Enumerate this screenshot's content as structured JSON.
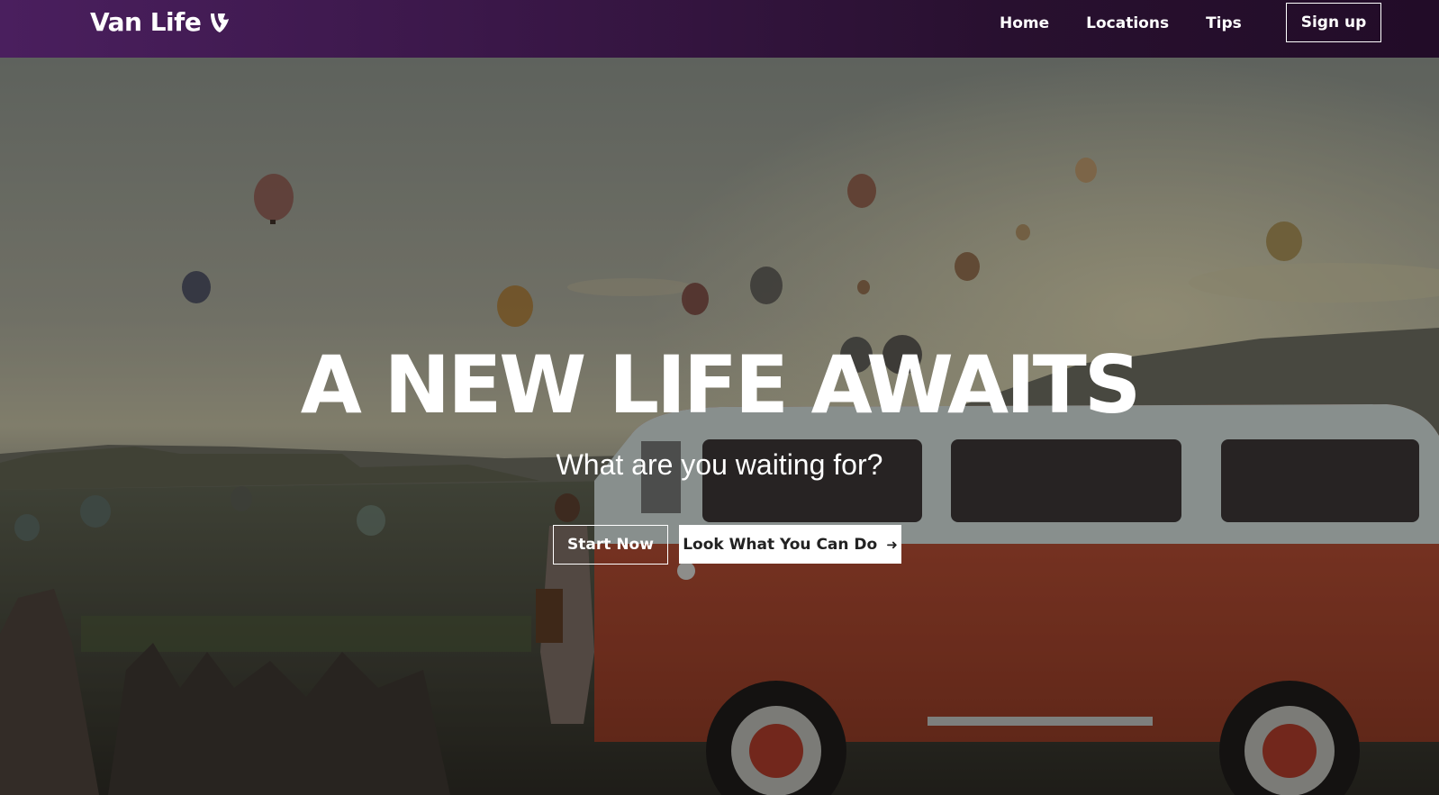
{
  "navbar": {
    "brand": "Van Life",
    "logo_icon": "typo3-logo-icon",
    "links": [
      {
        "label": "Home"
      },
      {
        "label": "Locations"
      },
      {
        "label": "Tips"
      }
    ],
    "signup_label": "Sign up"
  },
  "hero": {
    "title": "A NEW LIFE AWAITS",
    "subtitle": "What are you waiting for?",
    "primary_cta": "Start Now",
    "secondary_cta": "Look What You Can Do",
    "secondary_cta_icon": "arrow-right-icon",
    "background_description_colors": {
      "sky_top": "#8b9189",
      "sky_bottom": "#c5c3a8",
      "van_body": "#b64b32",
      "van_roof": "#c9d3d0"
    }
  },
  "colors": {
    "navbar_start": "#4a1f5e",
    "navbar_end": "#220c28",
    "text_on_dark": "#ffffff"
  }
}
